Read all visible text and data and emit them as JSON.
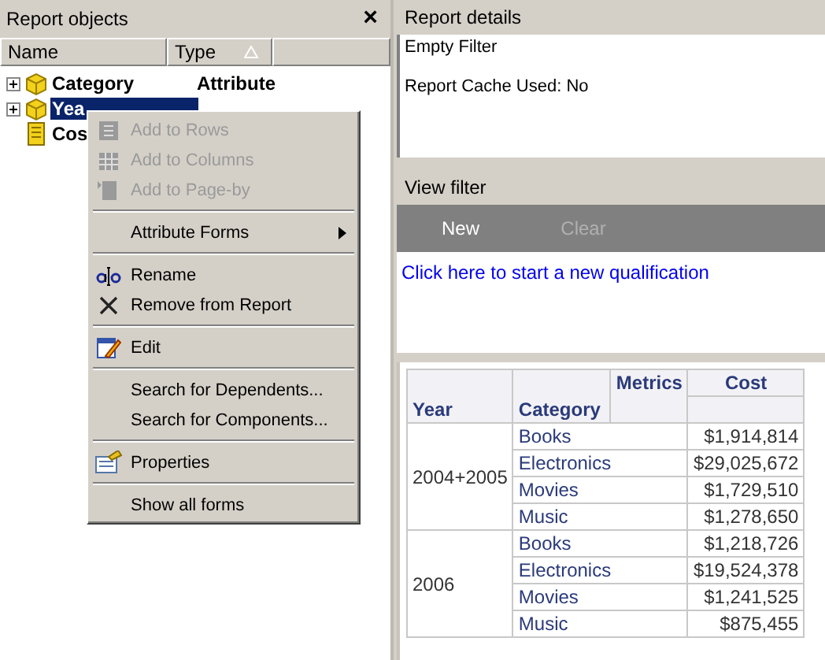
{
  "left_panel": {
    "title": "Report objects",
    "close": "×",
    "columns": [
      {
        "label": "Name"
      },
      {
        "label": "Type",
        "sort_icon": true
      }
    ],
    "tree": [
      {
        "name": "Category",
        "type": "Attribute",
        "selected": false,
        "kind": "attribute"
      },
      {
        "name": "Yea",
        "selected": true,
        "kind": "attribute"
      },
      {
        "name": "Cos",
        "selected": false,
        "kind": "metric"
      }
    ]
  },
  "context_menu": [
    {
      "kind": "item",
      "label": "Add to Rows",
      "disabled": true
    },
    {
      "kind": "item",
      "label": "Add to Columns",
      "disabled": true
    },
    {
      "kind": "item",
      "label": "Add to Page-by",
      "disabled": true
    },
    {
      "kind": "separator"
    },
    {
      "kind": "item",
      "label": "Attribute Forms",
      "disabled": false,
      "submenu": true
    },
    {
      "kind": "separator"
    },
    {
      "kind": "item",
      "label": "Rename",
      "disabled": false
    },
    {
      "kind": "item",
      "label": "Remove from Report",
      "disabled": false
    },
    {
      "kind": "separator"
    },
    {
      "kind": "item",
      "label": "Edit",
      "disabled": false
    },
    {
      "kind": "separator"
    },
    {
      "kind": "item",
      "label": "Search for Dependents...",
      "disabled": false
    },
    {
      "kind": "item",
      "label": "Search for Components...",
      "disabled": false
    },
    {
      "kind": "separator"
    },
    {
      "kind": "item",
      "label": "Properties",
      "disabled": false
    },
    {
      "kind": "separator"
    },
    {
      "kind": "item",
      "label": "Show all forms",
      "disabled": false
    }
  ],
  "report_details": {
    "title": "Report details",
    "lines": [
      "Empty Filter",
      "Report Cache Used: No"
    ]
  },
  "view_filter": {
    "title": "View filter",
    "buttons": [
      {
        "label": "New",
        "disabled": false
      },
      {
        "label": "Clear",
        "disabled": true
      }
    ],
    "link": "Click here to start a new qualification"
  },
  "grid": {
    "row_headers": [
      "Year",
      "Category"
    ],
    "metrics_label": "Metrics",
    "metric": "Cost",
    "groups": [
      {
        "year": "2004+2005",
        "rows": [
          [
            "Books",
            "$1,914,814"
          ],
          [
            "Electronics",
            "$29,025,672"
          ],
          [
            "Movies",
            "$1,729,510"
          ],
          [
            "Music",
            "$1,278,650"
          ]
        ]
      },
      {
        "year": "2006",
        "rows": [
          [
            "Books",
            "$1,218,726"
          ],
          [
            "Electronics",
            "$19,524,378"
          ],
          [
            "Movies",
            "$1,241,525"
          ],
          [
            "Music",
            "$875,455"
          ]
        ]
      }
    ]
  }
}
